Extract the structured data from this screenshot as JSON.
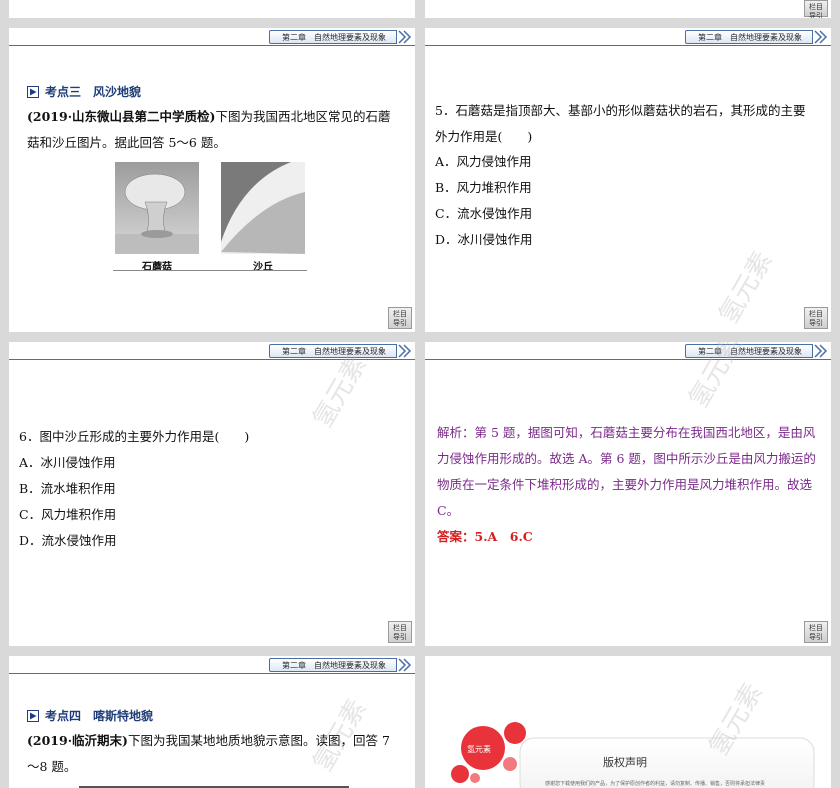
{
  "header": {
    "chapter": "第二章　自然地理要素及现象"
  },
  "nav_button": {
    "line1": "栏目",
    "line2": "导引"
  },
  "slide_topic3": {
    "topic": "考点三　风沙地貌",
    "source": "(2019·山东微山县第二中学质检)",
    "intro": "下图为我国西北地区常见的石蘑菇和沙丘图片。据此回答 5～6 题。",
    "fig1_caption": "石蘑菇",
    "fig2_caption": "沙丘"
  },
  "slide_q5": {
    "question": "5．石蘑菇是指顶部大、基部小的形似蘑菇状的岩石，其形成的主要外力作用是(　　)",
    "options": [
      "A．风力侵蚀作用",
      "B．风力堆积作用",
      "C．流水侵蚀作用",
      "D．冰川侵蚀作用"
    ]
  },
  "slide_q6": {
    "question": "6．图中沙丘形成的主要外力作用是(　　)",
    "options": [
      "A．冰川侵蚀作用",
      "B．流水堆积作用",
      "C．风力堆积作用",
      "D．流水侵蚀作用"
    ]
  },
  "slide_analysis": {
    "analysis": "解析：第 5 题，据图可知，石蘑菇主要分布在我国西北地区，是由风力侵蚀作用形成的。故选 A。第 6 题，图中所示沙丘是由风力搬运的物质在一定条件下堆积形成的，主要外力作用是风力堆积作用。故选 C。",
    "answer": "答案：5.A　6.C"
  },
  "slide_topic4": {
    "topic": "考点四　喀斯特地貌",
    "source": "(2019·临沂期末)",
    "intro": "下图为我国某地地质地貌示意图。读图，回答 7～8 题。"
  },
  "slide_copyright": {
    "title": "版权声明",
    "brand": "氢元素",
    "line": "感谢您下载使用我们的产品，为了保护原创作者的利益，请勿复制、传播、销售，否则将承担法律责"
  },
  "watermark": "氢元素"
}
